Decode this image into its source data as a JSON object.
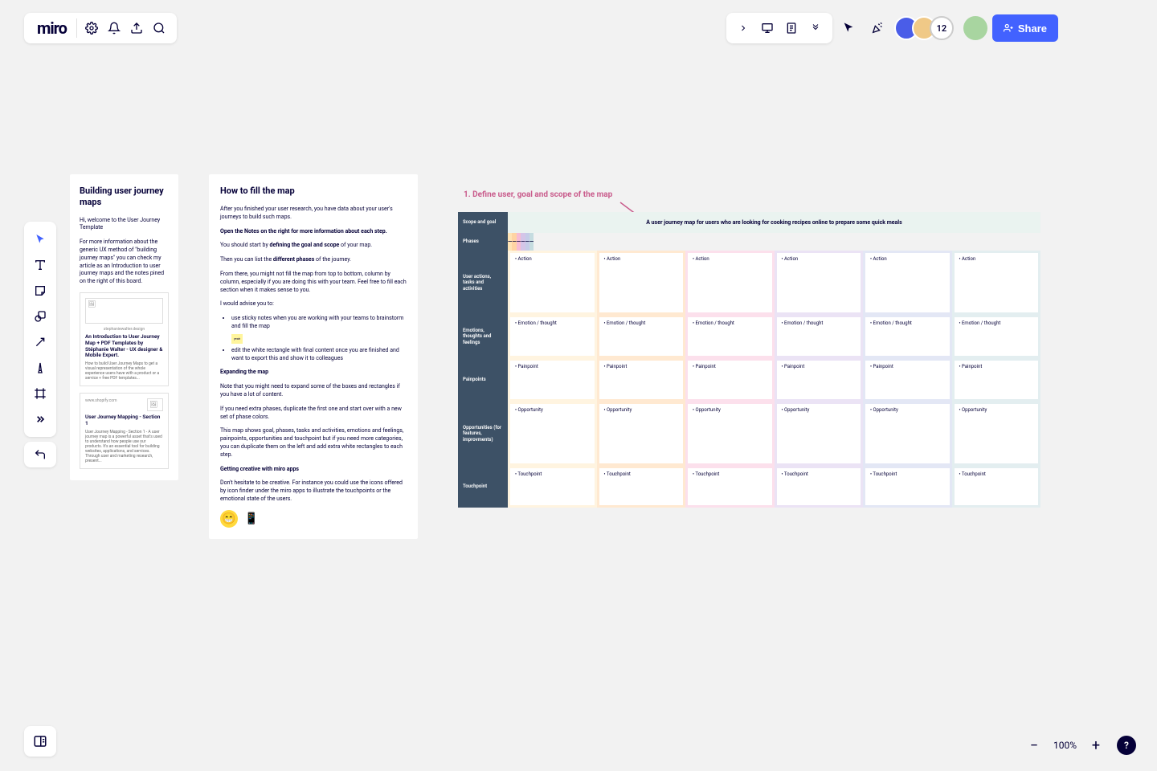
{
  "logo": "miro",
  "share_label": "Share",
  "avatar_count": "12",
  "zoom": "100%",
  "card1": {
    "title": "Building user journey maps",
    "p1": "Hi, welcome to the User Journey Template",
    "p2": "For more information about the generic UX method of \"building journey maps\" you can check my article as an Introduction to user journey maps and the notes pined on the right of this board.",
    "link1_domain": "stephaniewalter.design",
    "link1_title": "An Introduction to User Journey Map + PDF Templates by Stéphanie Walter - UX designer & Mobile Expert.",
    "link1_desc": "How to build User Journey Maps to get a visual representation of the whole experience users have with a product or a service + free PDF templates...",
    "link2_domain": "www.shopify.com",
    "link2_title": "User Journey Mapping - Section 1",
    "link2_desc": "User Journey Mapping - Section 1 - A user journey map is a powerful asset that's used to understand how people use our products. It's an essential tool for building websites, applications, and services. Through user and marketing research, present..."
  },
  "card2": {
    "title": "How to fill the map",
    "p1": "After you finished your user research, you have data about your user's journeys to build such maps.",
    "p2_b": "Open the Notes on the right for more information about each step.",
    "p3a": "You should start by ",
    "p3b": "defining the goal and scope",
    "p3c": " of your map.",
    "p4a": "Then you can list the ",
    "p4b": "different phases",
    "p4c": " of the journey.",
    "p5": "From there, you might not fill the map from top to bottom, column by column, especially if you are doing this with your team. Feel free to fill each section when it makes sense to you.",
    "p6": "I would advise you to:",
    "li1": "use sticky notes when you are working with your teams to brainstorm and fill the map",
    "li2": "edit the white rectangle with final content once you are finished and want to export this and show it to colleagues",
    "h_expand": "Expanding the map",
    "p7": "Note that you might need to expand some of the boxes and rectangles if you have a lot of content.",
    "p8": "If you need extra phases, duplicate the first one and start over with a new set of phase colors.",
    "p9": "This map shows goal, phases, tasks and activities, emotions and feelings, painpoints, opportunities and touchpoint but if you need more categories, you can duplicate them on the left and add extra white rectangles to each step.",
    "h_creative": "Getting creative with miro apps",
    "p10": "Don't hesitate to be creative. For instance you could use the icons offered by icon finder under the miro apps to illustrate the touchpoints or the emotional state of the users."
  },
  "map": {
    "title": "1. Define user, goal and scope of the map",
    "scope_label": "Scope and goal",
    "scope_text": "A user journey map for users who are looking for cooking recipes online to prepare some quick meals",
    "phases_label": "Phases",
    "phase_dash": "—",
    "row_actions": "User actions, tasks and activities",
    "row_emotions": "Emotions, thoughts and feelings",
    "row_painpoints": "Painpoints",
    "row_opportunities": "Opportunities (for features, improvments)",
    "row_touchpoint": "Touchpoint",
    "cell_action": "Action",
    "cell_emotion": "Emotion / thought",
    "cell_painpoint": "Painpoint",
    "cell_opportunity": "Opportunity",
    "cell_touchpoint": "Touchpoint"
  }
}
